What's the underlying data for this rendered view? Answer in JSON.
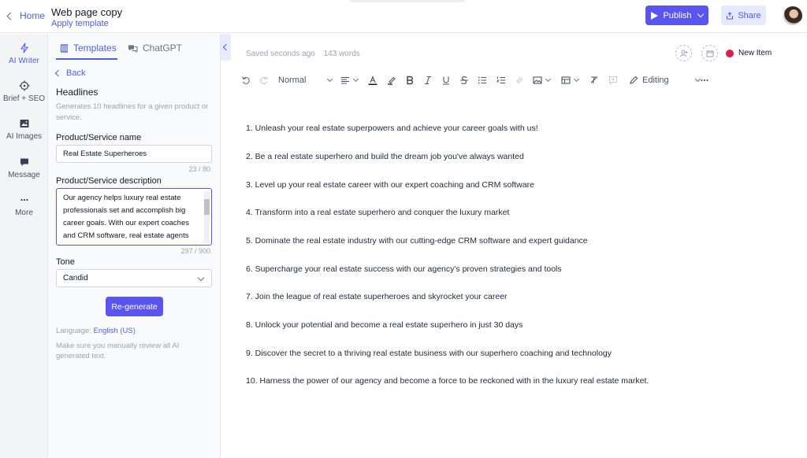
{
  "topbar": {
    "home_label": "Home",
    "doc_title": "Web page copy",
    "apply_template": "Apply template",
    "publish_label": "Publish",
    "share_label": "Share"
  },
  "rail": {
    "items": [
      {
        "label": "AI Writer",
        "icon": "lightning-icon"
      },
      {
        "label": "Brief + SEO",
        "icon": "target-icon"
      },
      {
        "label": "AI Images",
        "icon": "image-icon"
      },
      {
        "label": "Message",
        "icon": "chat-icon"
      },
      {
        "label": "More",
        "icon": "more-icon"
      }
    ]
  },
  "panel": {
    "tabs": [
      {
        "label": "Templates",
        "icon": "templates-icon"
      },
      {
        "label": "ChatGPT",
        "icon": "chatgpt-icon"
      }
    ],
    "back_label": "Back",
    "section_title": "Headlines",
    "section_desc": "Generates 10 headlines for a given product or service.",
    "name_label": "Product/Service name",
    "name_value": "Real Estate Superheroes",
    "name_counter": "23 / 80",
    "desc_label": "Product/Service description",
    "desc_value": "Our agency helps luxury real estate professionals set and accomplish big career goals. With our expert coaches and CRM software, real estate agents",
    "desc_counter": "297 / 900",
    "tone_label": "Tone",
    "tone_value": "Candid",
    "regenerate_label": "Re-generate",
    "language_label": "Language:",
    "language_value": "English (US)",
    "note": "Make sure you manually review all AI generated text."
  },
  "editor": {
    "saved_status": "Saved seconds ago",
    "word_count": "143 words",
    "new_item_label": "New Item",
    "style_select": "Normal",
    "mode_select": "Editing",
    "headlines": [
      "1. Unleash your real estate superpowers and achieve your career goals with us!",
      "2. Be a real estate superhero and build the dream job you've always wanted",
      "3. Level up your real estate career with our expert coaching and CRM software",
      "4. Transform into a real estate superhero and conquer the luxury market",
      "5. Dominate the real estate industry with our cutting-edge CRM software and expert guidance",
      "6. Supercharge your real estate success with our agency's proven strategies and tools",
      "7. Join the league of real estate superheroes and skyrocket your career",
      "8. Unlock your potential and become a real estate superhero in just 30 days",
      "9. Discover the secret to a thriving real estate business with our superhero coaching and technology",
      "10. Harness the power of our agency and become a force to be reckoned with in the luxury real estate market."
    ]
  },
  "colors": {
    "accent": "#5a55f0",
    "link": "#4f5fe0",
    "new_item_dot": "#dc1f48"
  }
}
